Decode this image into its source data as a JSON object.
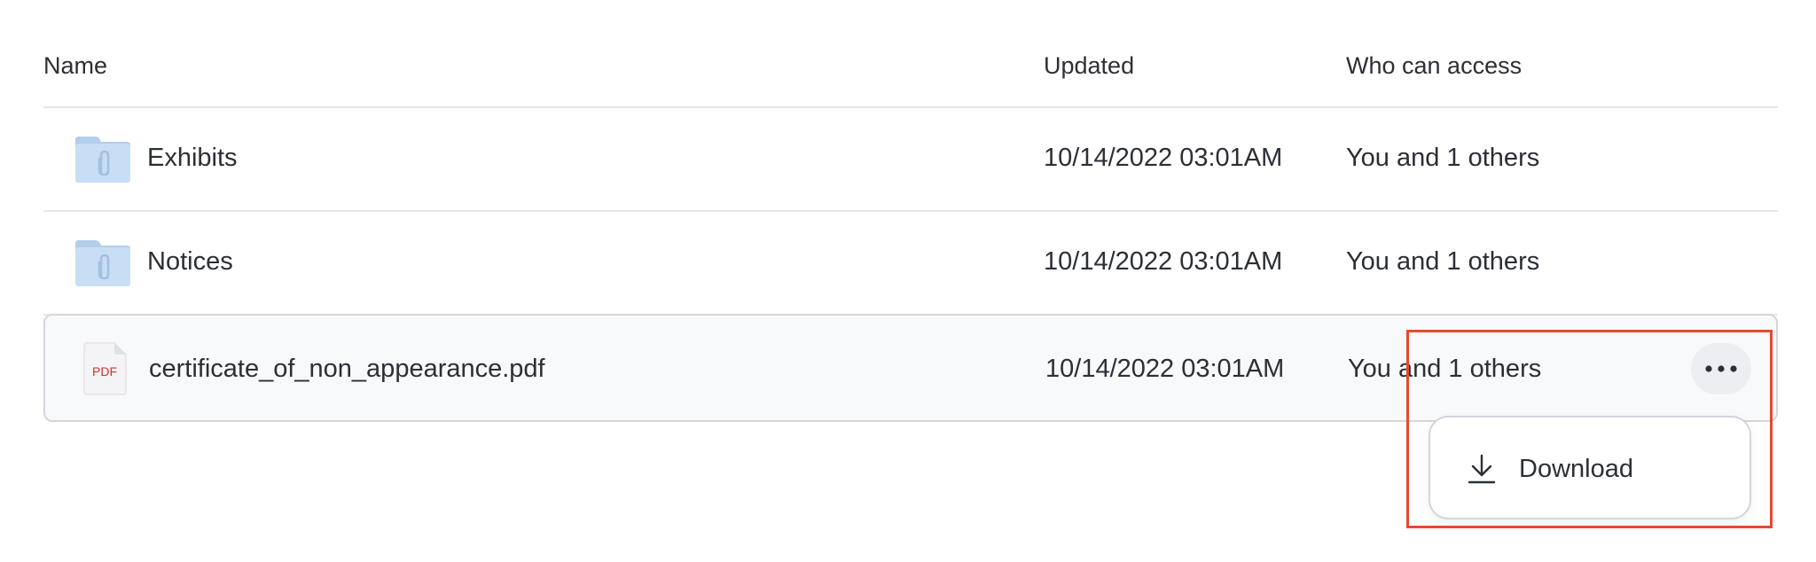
{
  "table": {
    "headers": {
      "name": "Name",
      "updated": "Updated",
      "access": "Who can access"
    },
    "rows": [
      {
        "type": "folder",
        "icon": "folder-paperclip-icon",
        "name": "Exhibits",
        "updated": "10/14/2022 03:01AM",
        "access": "You and 1 others"
      },
      {
        "type": "folder",
        "icon": "folder-paperclip-icon",
        "name": "Notices",
        "updated": "10/14/2022 03:01AM",
        "access": "You and 1 others"
      },
      {
        "type": "file",
        "icon": "pdf-file-icon",
        "icon_label": "PDF",
        "name": "certificate_of_non_appearance.pdf",
        "updated": "10/14/2022 03:01AM",
        "access": "You and 1 others",
        "selected": true
      }
    ]
  },
  "menu": {
    "more_icon": "more-horizontal-icon",
    "items": [
      {
        "icon": "download-icon",
        "label": "Download"
      }
    ]
  },
  "colors": {
    "text": "#2b2f36",
    "divider": "#e6e7ea",
    "selected_row_bg": "#f8f9fb",
    "selected_row_border": "#d3d6dc",
    "folder": "#c8def5",
    "folder_tab": "#b3cdea",
    "pdf_label": "#d0342c",
    "highlight": "#e8492c"
  }
}
